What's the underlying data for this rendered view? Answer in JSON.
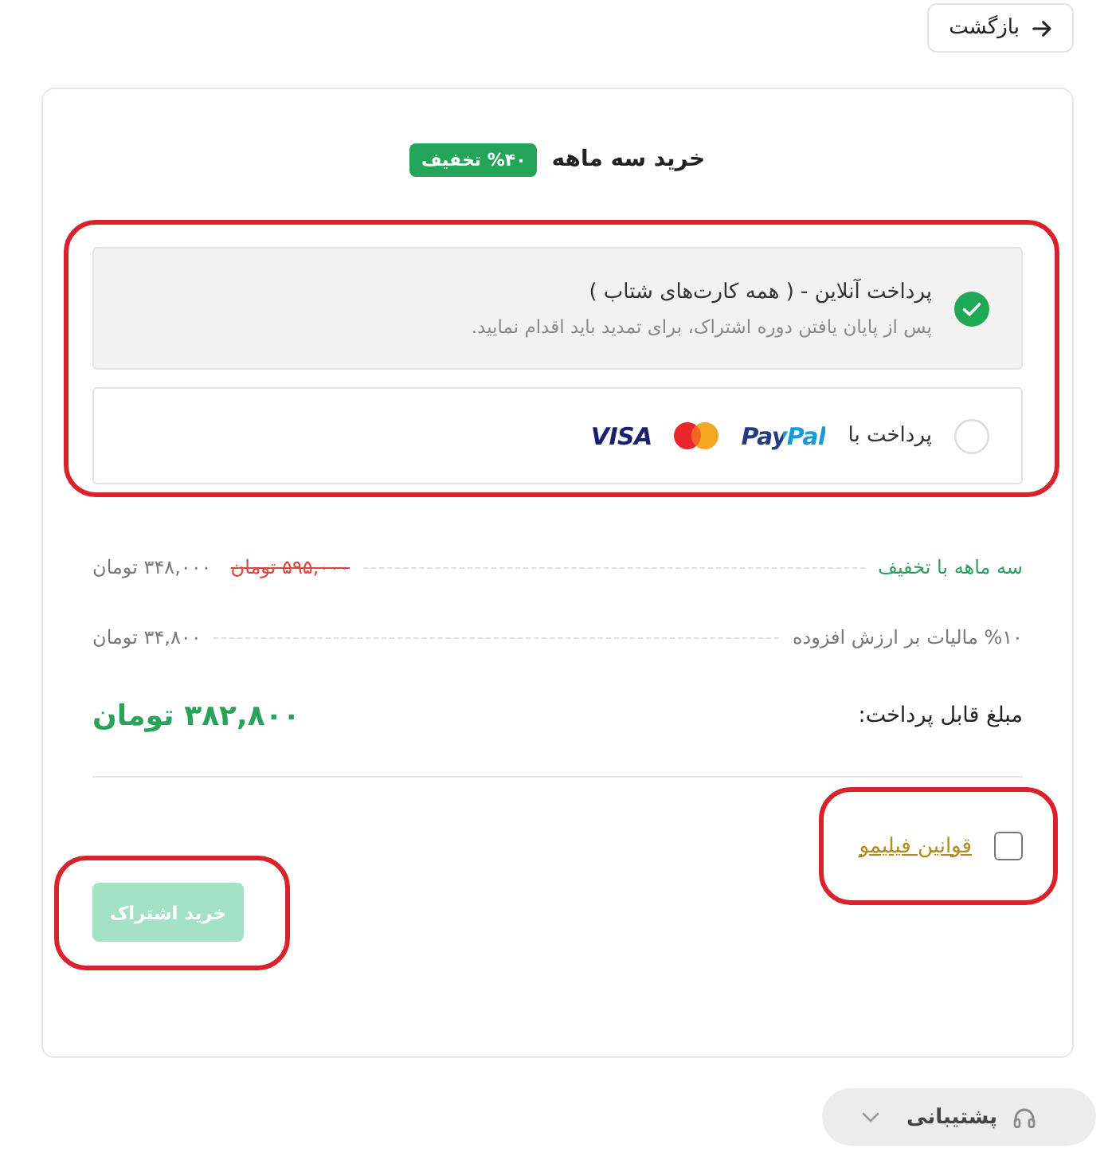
{
  "back_button": {
    "label": "بازگشت"
  },
  "plan": {
    "title": "خرید سه ماهه",
    "badge": "%۴۰ تخفیف"
  },
  "payment_methods": {
    "highlighted": true,
    "options": [
      {
        "kind": "online",
        "title": "پرداخت آنلاین - ( همه کارت‌های شتاب )",
        "description": "پس از پایان یافتن دوره اشتراک، برای تمدید باید اقدام نمایید.",
        "selected": true
      },
      {
        "kind": "cards",
        "label": "پرداخت با",
        "logos": [
          {
            "kind": "paypal",
            "text": "PayPal"
          },
          {
            "kind": "mastercard"
          },
          {
            "kind": "visa",
            "text": "VISA"
          }
        ],
        "selected": false
      }
    ]
  },
  "summary": {
    "rows": [
      {
        "kind": "discount",
        "label": "سه ماهه با تخفیف",
        "old_price": "۵۹۵,۰۰۰ تومان",
        "price": "۳۴۸,۰۰۰ تومان"
      },
      {
        "kind": "tax",
        "label": "%۱۰ مالیات بر ارزش افزوده",
        "price": "۳۴,۸۰۰ تومان"
      }
    ],
    "total": {
      "label": "مبلغ قابل پرداخت:",
      "amount": "۳۸۲,۸۰۰ تومان"
    }
  },
  "terms": {
    "label": "قوانین فیلیمو",
    "checked": false,
    "highlighted": true
  },
  "submit_button": {
    "label": "خرید اشتراک",
    "disabled": true,
    "highlighted": true
  },
  "support": {
    "label": "پشتیبانی",
    "expanded": false
  }
}
